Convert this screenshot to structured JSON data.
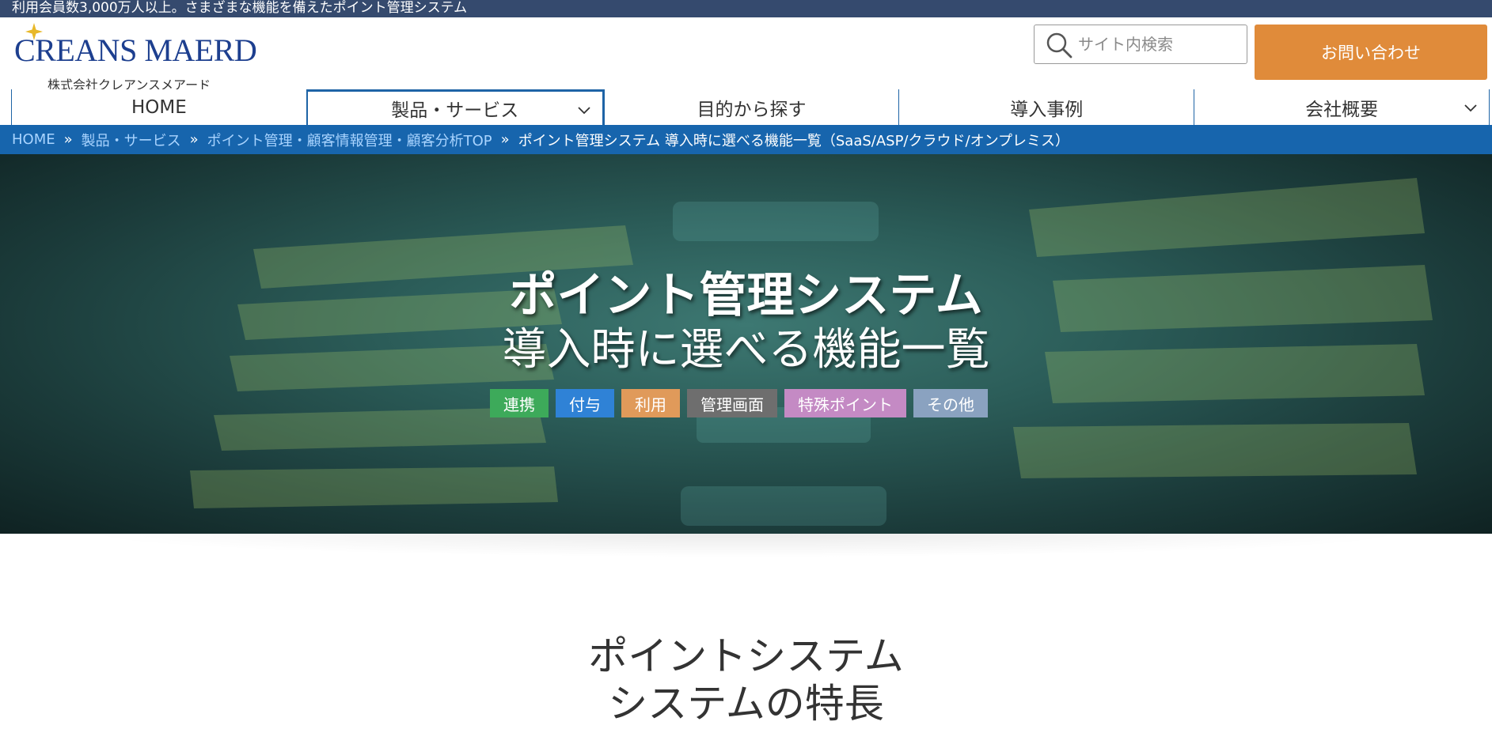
{
  "topbar": {
    "text": "利用会員数3,000万人以上。さまざまな機能を備えたポイント管理システム"
  },
  "logo": {
    "main": "CREANS MAERD",
    "sub": "株式会社クレアンスメアード"
  },
  "search": {
    "placeholder": "サイト内検索",
    "icon": "search-icon"
  },
  "contact": {
    "label": "お問い合わせ"
  },
  "nav": {
    "items": [
      {
        "label": "HOME"
      },
      {
        "label": "製品・サービス"
      },
      {
        "label": "目的から探す"
      },
      {
        "label": "導入事例"
      },
      {
        "label": "会社概要"
      }
    ]
  },
  "breadcrumb": {
    "items": [
      "HOME",
      "製品・サービス",
      "ポイント管理・顧客情報管理・顧客分析TOP"
    ],
    "separator": "»",
    "current": "ポイント管理システム 導入時に選べる機能一覧（SaaS/ASP/クラウド/オンプレミス）"
  },
  "hero": {
    "title1": "ポイント管理システム",
    "title2": "導入時に選べる機能一覧",
    "tags": [
      {
        "label": "連携",
        "color": "#3daa5a"
      },
      {
        "label": "付与",
        "color": "#2f82d6"
      },
      {
        "label": "利用",
        "color": "#e09a5a"
      },
      {
        "label": "管理画面",
        "color": "#6e6e6e"
      },
      {
        "label": "特殊ポイント",
        "color": "#c48ac4"
      },
      {
        "label": "その他",
        "color": "#8aa2c0"
      }
    ]
  },
  "section": {
    "title1": "ポイントシステム",
    "title2": "システムの特長"
  },
  "colors": {
    "topbar": "#354a6e",
    "breadcrumb": "#1765ad",
    "contact": "#e08b3a",
    "brand": "#1d3f8f"
  }
}
